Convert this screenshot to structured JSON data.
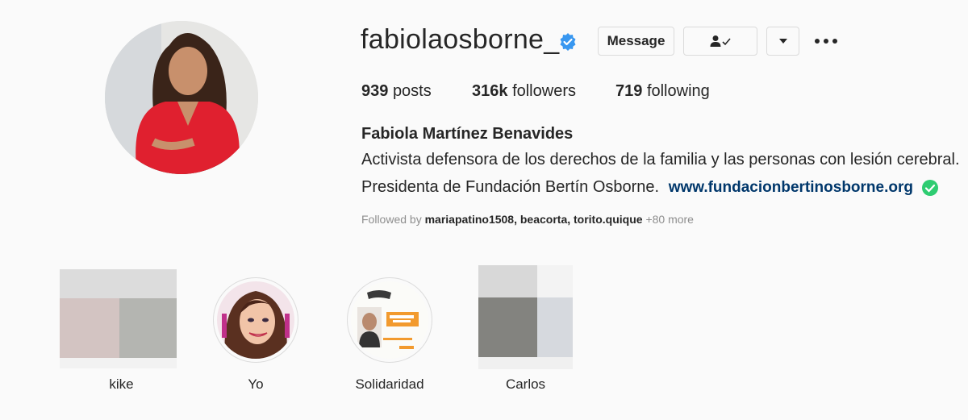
{
  "profile": {
    "username": "fabiolaosborne_",
    "verified": true,
    "avatar_icon": "profile-photo",
    "buttons": {
      "message": "Message",
      "following_icon": "person-check-icon",
      "dropdown_icon": "caret-down-icon",
      "more_icon": "ellipsis-icon"
    },
    "stats": {
      "posts_count": "939",
      "posts_label": "posts",
      "followers_count": "316k",
      "followers_label": "followers",
      "following_count": "719",
      "following_label": "following"
    },
    "full_name": "Fabiola Martínez Benavides",
    "bio_line1": "Activista defensora de los derechos de la familia y las personas con lesión cerebral.",
    "bio_line2": "Presidenta de Fundación Bertín Osborne.",
    "website": "www.fundacionbertinosborne.org",
    "followed_by": {
      "prefix": "Followed by",
      "users": "mariapatino1508, beacorta, torito.quique",
      "more": "+80 more"
    }
  },
  "highlights": [
    {
      "label": "kike"
    },
    {
      "label": "Yo"
    },
    {
      "label": "Solidaridad"
    },
    {
      "label": "Carlos"
    }
  ],
  "colors": {
    "background": "#fafafa",
    "verified_blue": "#3897f0",
    "link": "#00376b",
    "check_green": "#2ecc71",
    "muted": "#8e8e8e"
  }
}
